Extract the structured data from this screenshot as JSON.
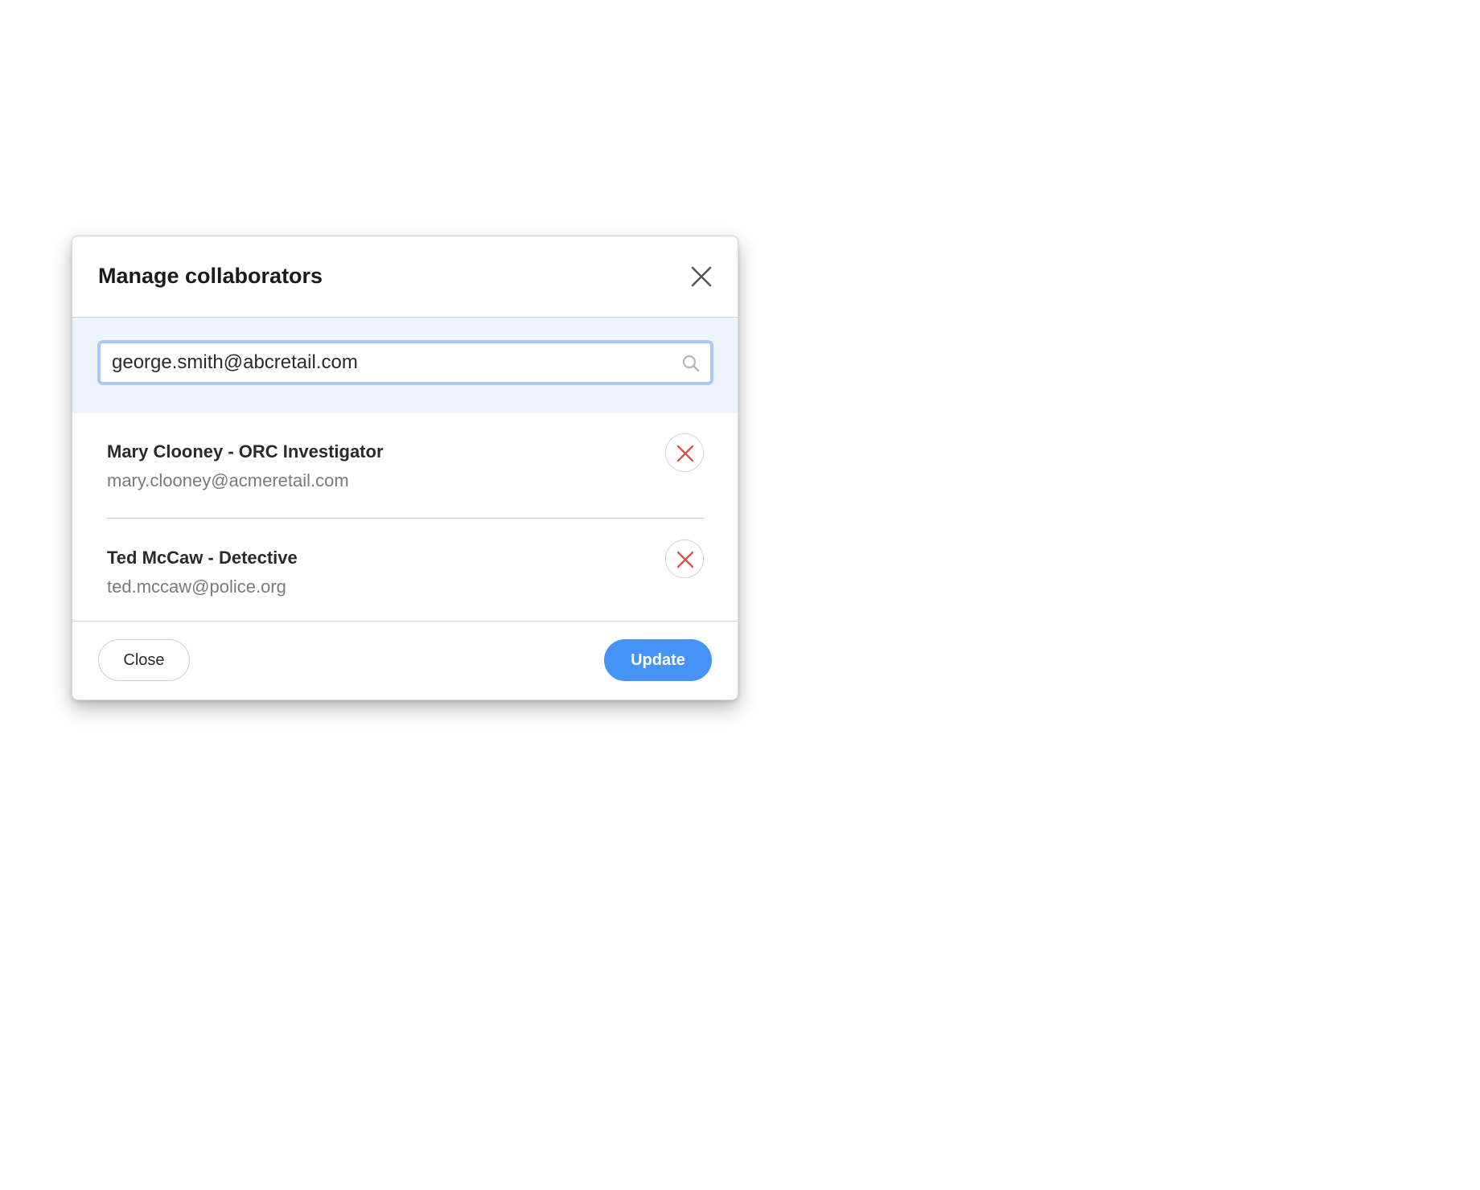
{
  "dialog": {
    "title": "Manage collaborators"
  },
  "search": {
    "value": "george.smith@abcretail.com",
    "icon": "search-icon"
  },
  "collaborators": [
    {
      "name": "Mary Clooney - ORC Investigator",
      "email": "mary.clooney@acmeretail.com"
    },
    {
      "name": "Ted McCaw - Detective",
      "email": "ted.mccaw@police.org"
    }
  ],
  "footer": {
    "close_label": "Close",
    "update_label": "Update"
  },
  "colors": {
    "primary": "#4593f6",
    "remove": "#d9534f",
    "search_band": "#edf4fd",
    "search_focus_border": "#a9c8f4"
  }
}
